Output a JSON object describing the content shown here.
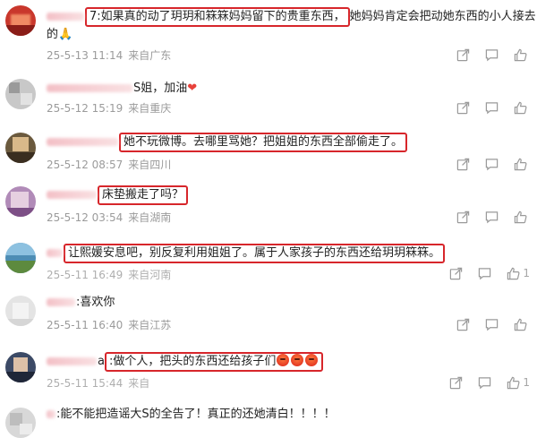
{
  "comments": [
    {
      "name_prefix": "",
      "name_tail": "7",
      "text": ":如果真的动了玥玥和箖箖妈妈留下的贵重东西，",
      "text_rest": "她妈妈肯定会把动她东西的小人接去",
      "text2": "的",
      "emoji": "🙏",
      "date": "25-5-13 11:14",
      "location": "来自广东",
      "likes": ""
    },
    {
      "name_tail": "S",
      "text": "姐，加油",
      "emoji": "❤",
      "date": "25-5-12 15:19",
      "location": "来自重庆",
      "likes": ""
    },
    {
      "text": "她不玩微博。去哪里骂她？把姐姐的东西全部偷走了。",
      "date": "25-5-12 08:57",
      "location": "来自四川",
      "likes": ""
    },
    {
      "text": "床垫搬走了吗？",
      "date": "25-5-12 03:54",
      "location": "来自湖南",
      "likes": ""
    },
    {
      "text": "让熙媛安息吧，别反复利用姐姐了。属于人家孩子的东西还给玥玥箖箖。",
      "date": "25-5-11 16:49",
      "location": "来自河南",
      "likes": "1"
    },
    {
      "text": ":喜欢你",
      "date": "25-5-11 16:40",
      "location": "来自江苏",
      "likes": ""
    },
    {
      "name_tail": "a",
      "text": ":做个人，把头的东西还给孩子们",
      "date": "25-5-11 15:44",
      "location": "来自",
      "likes": "1"
    },
    {
      "text": ":能不能把造谣大S的全告了！真正的还她清白！！！！",
      "date": "",
      "location": "",
      "likes": ""
    }
  ],
  "icons": {
    "share": "share-icon",
    "comment": "comment-icon",
    "like": "thumbs-up-icon"
  }
}
